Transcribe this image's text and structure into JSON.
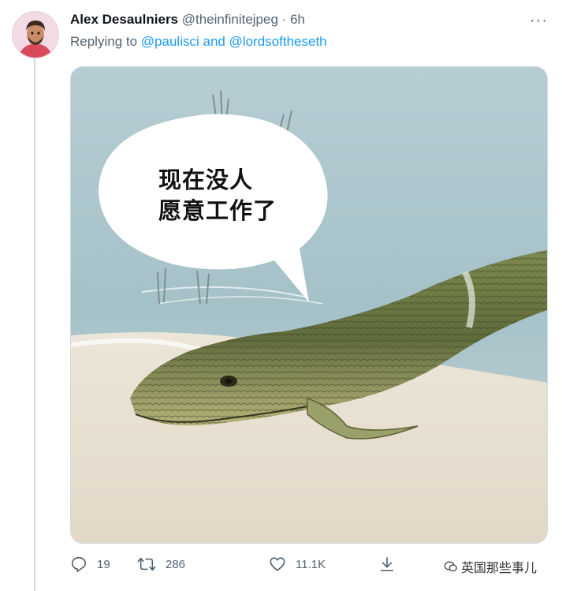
{
  "tweet": {
    "author_name": "Alex Desaulniers",
    "handle": "@theinfinitejpeg",
    "separator": "·",
    "time": "6h",
    "more_label": "···",
    "replying_prefix": "Replying to",
    "mention_1": "@paulisci",
    "mention_and": "and",
    "mention_2": "@lordsoftheseth"
  },
  "image": {
    "bubble_line_1": "现在没人",
    "bubble_line_2": "愿意工作了"
  },
  "actions": {
    "reply_count": "19",
    "retweet_count": "286",
    "like_count": "11.1K"
  },
  "watermark": {
    "text": "英国那些事儿"
  },
  "colors": {
    "link": "#1d9bf0",
    "muted": "#536471"
  }
}
